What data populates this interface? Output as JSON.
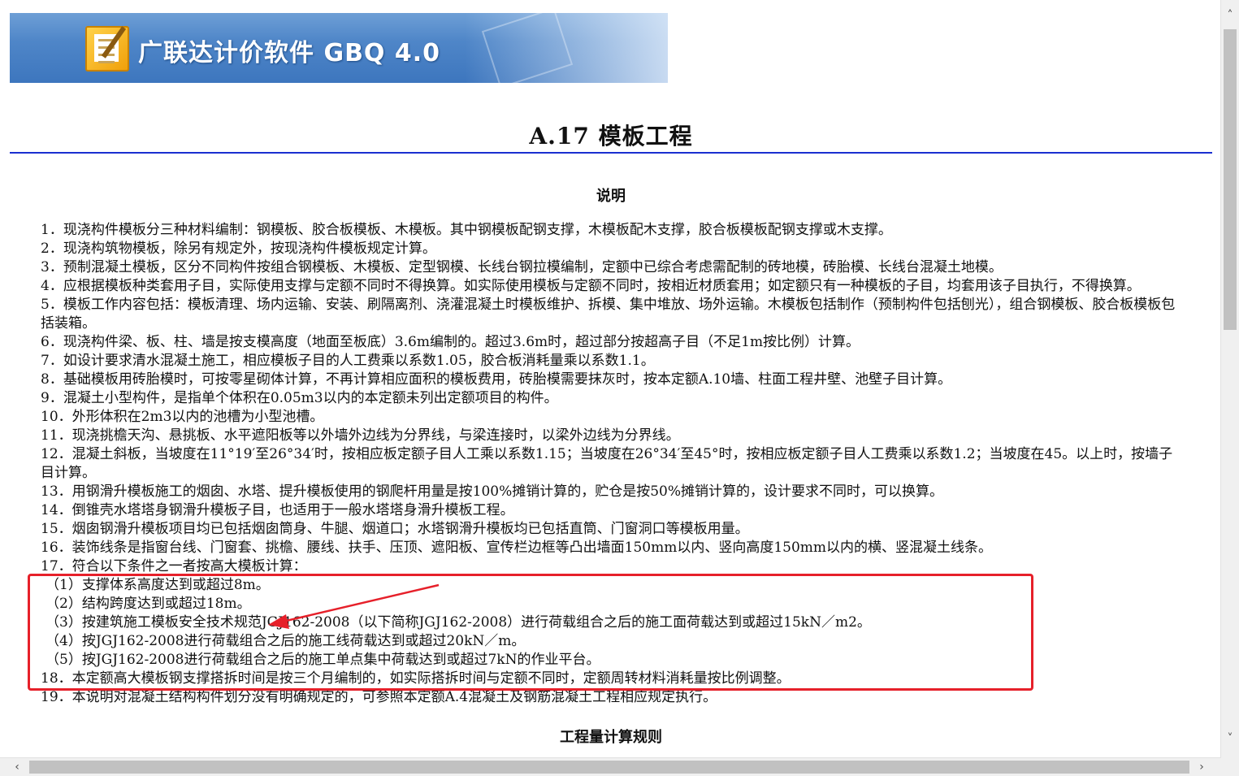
{
  "banner": {
    "title": "广联达计价软件 GBQ 4.0",
    "logo_icon": "notepad-pencil-icon"
  },
  "page_title": "A.17 模板工程",
  "section_heading": "说明",
  "items": [
    "1．现浇构件模板分三种材料编制：钢模板、胶合板模板、木模板。其中钢模板配钢支撑，木模板配木支撑，胶合板模板配钢支撑或木支撑。",
    "2．现浇构筑物模板，除另有规定外，按现浇构件模板规定计算。",
    "3．预制混凝土模板，区分不同构件按组合钢模板、木模板、定型钢模、长线台钢拉模编制，定额中已综合考虑需配制的砖地模，砖胎模、长线台混凝土地模。",
    "4．应根据模板种类套用子目，实际使用支撑与定额不同时不得换算。如实际使用模板与定额不同时，按相近材质套用；如定额只有一种模板的子目，均套用该子目执行，不得换算。",
    "5．模板工作内容包括：模板清理、场内运输、安装、刷隔离剂、浇灌混凝土时模板维护、拆模、集中堆放、场外运输。木模板包括制作（预制构件包括刨光），组合钢模板、胶合板模板包括装箱。",
    "6．现浇构件梁、板、柱、墙是按支模高度（地面至板底）3.6m编制的。超过3.6m时，超过部分按超高子目（不足1m按比例）计算。",
    "7．如设计要求清水混凝土施工，相应模板子目的人工费乘以系数1.05，胶合板消耗量乘以系数1.1。",
    "8．基础模板用砖胎模时，可按零星砌体计算，不再计算相应面积的模板费用，砖胎模需要抹灰时，按本定额A.10墙、柱面工程井壁、池壁子目计算。",
    "9．混凝土小型构件，是指单个体积在0.05m3以内的本定额未列出定额项目的构件。",
    "10．外形体积在2m3以内的池槽为小型池槽。",
    "11．现浇挑檐天沟、悬挑板、水平遮阳板等以外墙外边线为分界线，与梁连接时，以梁外边线为分界线。",
    "12．混凝土斜板，当坡度在11°19′至26°34′时，按相应板定额子目人工乘以系数1.15；当坡度在26°34′至45°时，按相应板定额子目人工费乘以系数1.2；当坡度在45。以上时，按墙子目计算。",
    "13．用钢滑升模板施工的烟囱、水塔、提升模板使用的钢爬杆用量是按100%摊销计算的，贮仓是按50%摊销计算的，设计要求不同时，可以换算。",
    "14．倒锥壳水塔塔身钢滑升模板子目，也适用于一般水塔塔身滑升模板工程。",
    "15．烟囱钢滑升模板项目均已包括烟囱筒身、牛腿、烟道口；水塔钢滑升模板均已包括直筒、门窗洞口等模板用量。",
    "16．装饰线条是指窗台线、门窗套、挑檐、腰线、扶手、压顶、遮阳板、宣传栏边框等凸出墙面150mm以内、竖向高度150mm以内的横、竖混凝土线条。",
    "17．符合以下条件之一者按高大模板计算：",
    "（1）支撑体系高度达到或超过8m。",
    "（2）结构跨度达到或超过18m。",
    "（3）按建筑施工模板安全技术规范JGJ162-2008（以下简称JGJ162-2008）进行荷载组合之后的施工面荷载达到或超过15kN／m2。",
    "（4）按JGJ162-2008进行荷载组合之后的施工线荷载达到或超过20kN／m。",
    "（5）按JGJ162-2008进行荷载组合之后的施工单点集中荷载达到或超过7kN的作业平台。",
    "18．本定额高大模板钢支撑搭拆时间是按三个月编制的，如实际搭拆时间与定额不同时，定额周转材料消耗量按比例调整。",
    "19．本说明对混凝土结构构件划分没有明确规定的，可参照本定额A.4混凝土及钢筋混凝土工程相应规定执行。"
  ],
  "rules_heading": "工程量计算规则",
  "annotation": {
    "box_color": "#e6202a"
  },
  "scrollbar": {
    "up_icon": "chevron-up-icon",
    "down_icon": "chevron-down-icon",
    "left_icon": "chevron-left-icon",
    "right_icon": "chevron-right-icon"
  }
}
